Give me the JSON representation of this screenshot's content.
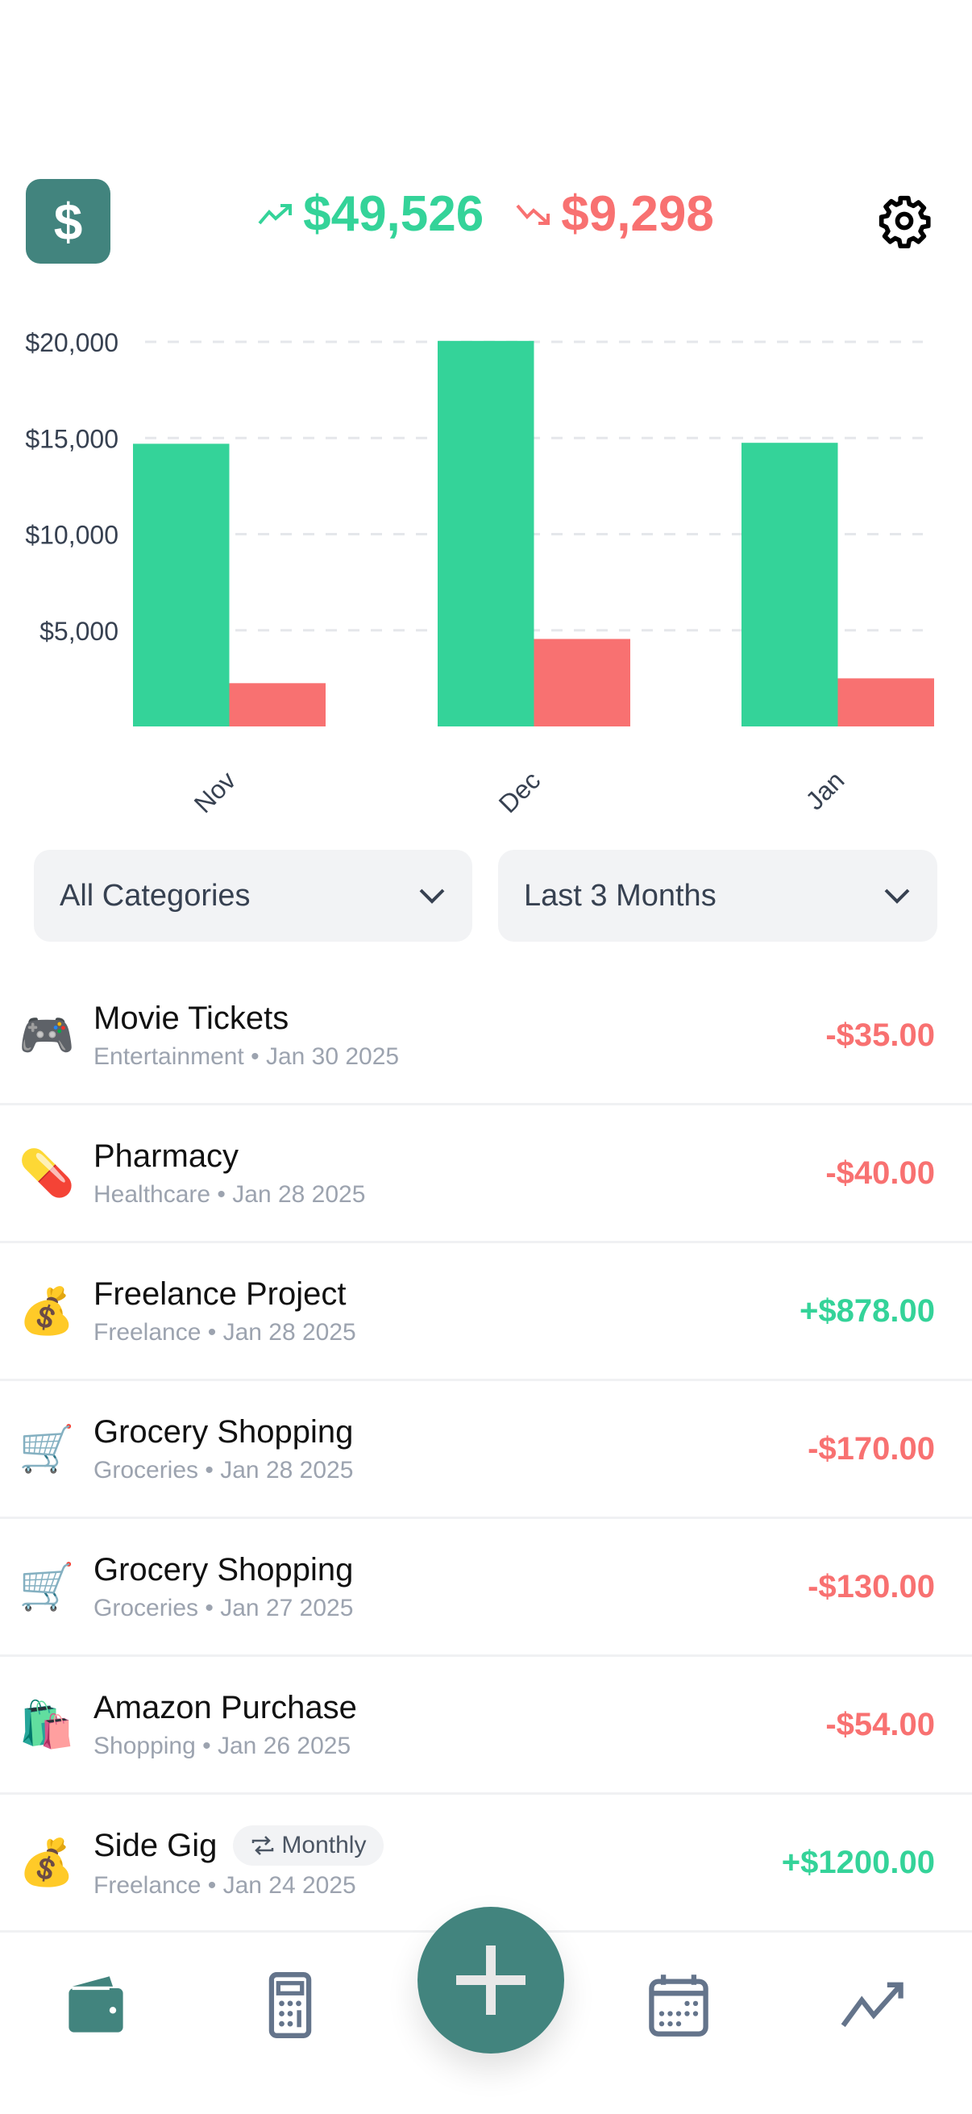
{
  "header": {
    "logo_symbol": "$",
    "income_total": "$49,526",
    "expense_total": "$9,298",
    "settings_icon": "gear-icon"
  },
  "colors": {
    "income": "#34d399",
    "expense": "#f87171",
    "accent": "#42847e"
  },
  "chart_data": {
    "type": "bar",
    "categories": [
      "Nov",
      "Dec",
      "Jan"
    ],
    "series": [
      {
        "values": [
          14700,
          20050,
          14750
        ],
        "color": "#34d399"
      },
      {
        "values": [
          2250,
          4550,
          2500
        ],
        "color": "#f87171"
      }
    ],
    "ylim": [
      0,
      20000
    ],
    "yticks": [
      5000,
      10000,
      15000,
      20000
    ],
    "ytick_labels": [
      "$5,000",
      "$10,000",
      "$15,000",
      "$20,000"
    ],
    "grid": true
  },
  "filters": {
    "category": "All Categories",
    "period": "Last 3 Months"
  },
  "transactions": [
    {
      "emoji": "🎮",
      "title": "Movie Tickets",
      "category": "Entertainment",
      "date": "Jan 30 2025",
      "amount": "-$35.00",
      "type": "expense"
    },
    {
      "emoji": "💊",
      "title": "Pharmacy",
      "category": "Healthcare",
      "date": "Jan 28 2025",
      "amount": "-$40.00",
      "type": "expense"
    },
    {
      "emoji": "💰",
      "title": "Freelance Project",
      "category": "Freelance",
      "date": "Jan 28 2025",
      "amount": "+$878.00",
      "type": "income"
    },
    {
      "emoji": "🛒",
      "title": "Grocery Shopping",
      "category": "Groceries",
      "date": "Jan 28 2025",
      "amount": "-$170.00",
      "type": "expense"
    },
    {
      "emoji": "🛒",
      "title": "Grocery Shopping",
      "category": "Groceries",
      "date": "Jan 27 2025",
      "amount": "-$130.00",
      "type": "expense"
    },
    {
      "emoji": "🛍️",
      "title": "Amazon Purchase",
      "category": "Shopping",
      "date": "Jan 26 2025",
      "amount": "-$54.00",
      "type": "expense"
    },
    {
      "emoji": "💰",
      "title": "Side Gig",
      "badge": "Monthly",
      "category": "Freelance",
      "date": "Jan 24 2025",
      "amount": "+$1200.00",
      "type": "income"
    }
  ],
  "nav": {
    "items": [
      "wallet-icon",
      "calculator-icon",
      "plus-icon",
      "calendar-icon",
      "trending-up-icon"
    ],
    "active": 0
  }
}
